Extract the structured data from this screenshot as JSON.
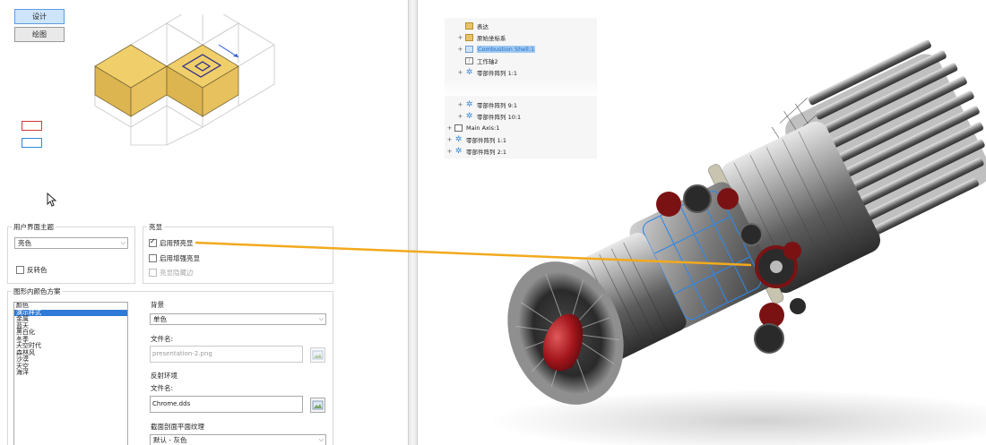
{
  "tabs": {
    "design": "设计",
    "drawing": "绘图"
  },
  "legend": {
    "red_color": "#d33a3a",
    "blue_color": "#2f8ae0"
  },
  "theme_group": {
    "title": "用户界面主题",
    "combo_value": "亮色",
    "reverse_color_label": "反转色",
    "reverse_color_checked": false
  },
  "highlight_group": {
    "title": "亮显",
    "enable_preselect_label": "启用预亮显",
    "enable_preselect_checked": true,
    "enable_enhanced_label": "启用增强亮显",
    "enable_enhanced_checked": false,
    "hidden_edges_label": "亮显隐藏边",
    "hidden_edges_checked": false
  },
  "scheme_group": {
    "title": "图形内颜色方案",
    "items": [
      "颜色",
      "演示样式",
      "金属",
      "蓝天",
      "黑白化",
      "冬季",
      "天空时代",
      "森林风",
      "沙漠",
      "天空",
      "海洋"
    ],
    "selected_index": 1
  },
  "background": {
    "label": "背景",
    "combo_value": "单色",
    "file_label": "文件名:",
    "file_value": "presentation-2.png"
  },
  "reflection": {
    "label": "反射环境",
    "file_label": "文件名:",
    "file_value": "Chrome.dds"
  },
  "section": {
    "label": "截面剖面平面纹理",
    "combo_value": "默认 - 灰色"
  },
  "tree": {
    "items_top": [
      {
        "label": "表达",
        "icon": "folder-icon",
        "expand": ""
      },
      {
        "label": "原始坐标系",
        "icon": "folder-icon",
        "expand": "+"
      },
      {
        "label": "Combustion Shell:1",
        "icon": "part-icon",
        "expand": "+",
        "highlight": true
      },
      {
        "label": "工作轴2",
        "icon": "axis-icon",
        "expand": ""
      },
      {
        "label": "零部件阵列 1:1",
        "icon": "gear-icon",
        "expand": "+"
      }
    ],
    "items_bottom": [
      {
        "label": "零部件阵列 9:1",
        "icon": "gear-icon",
        "expand": "+"
      },
      {
        "label": "零部件阵列 10:1",
        "icon": "gear-icon",
        "expand": "+"
      },
      {
        "label": "Main Axis:1",
        "icon": "assembly-icon",
        "expand": "+"
      },
      {
        "label": "零部件阵列 1:1",
        "icon": "gear-icon",
        "expand": "+"
      },
      {
        "label": "零部件阵列 2:1",
        "icon": "gear-icon",
        "expand": "+"
      }
    ]
  },
  "connector_color": "#f2a91c"
}
